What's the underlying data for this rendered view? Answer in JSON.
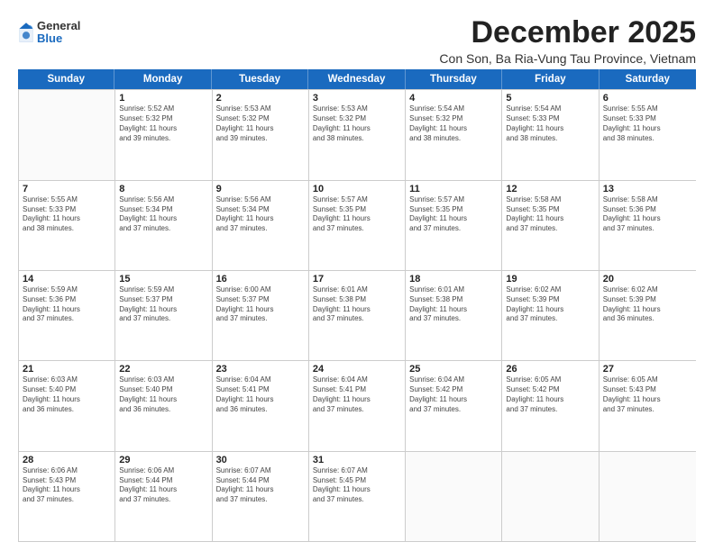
{
  "logo": {
    "general": "General",
    "blue": "Blue"
  },
  "title": "December 2025",
  "location": "Con Son, Ba Ria-Vung Tau Province, Vietnam",
  "days": [
    "Sunday",
    "Monday",
    "Tuesday",
    "Wednesday",
    "Thursday",
    "Friday",
    "Saturday"
  ],
  "weeks": [
    [
      {
        "day": "",
        "info": ""
      },
      {
        "day": "1",
        "info": "Sunrise: 5:52 AM\nSunset: 5:32 PM\nDaylight: 11 hours\nand 39 minutes."
      },
      {
        "day": "2",
        "info": "Sunrise: 5:53 AM\nSunset: 5:32 PM\nDaylight: 11 hours\nand 39 minutes."
      },
      {
        "day": "3",
        "info": "Sunrise: 5:53 AM\nSunset: 5:32 PM\nDaylight: 11 hours\nand 38 minutes."
      },
      {
        "day": "4",
        "info": "Sunrise: 5:54 AM\nSunset: 5:32 PM\nDaylight: 11 hours\nand 38 minutes."
      },
      {
        "day": "5",
        "info": "Sunrise: 5:54 AM\nSunset: 5:33 PM\nDaylight: 11 hours\nand 38 minutes."
      },
      {
        "day": "6",
        "info": "Sunrise: 5:55 AM\nSunset: 5:33 PM\nDaylight: 11 hours\nand 38 minutes."
      }
    ],
    [
      {
        "day": "7",
        "info": "Sunrise: 5:55 AM\nSunset: 5:33 PM\nDaylight: 11 hours\nand 38 minutes."
      },
      {
        "day": "8",
        "info": "Sunrise: 5:56 AM\nSunset: 5:34 PM\nDaylight: 11 hours\nand 37 minutes."
      },
      {
        "day": "9",
        "info": "Sunrise: 5:56 AM\nSunset: 5:34 PM\nDaylight: 11 hours\nand 37 minutes."
      },
      {
        "day": "10",
        "info": "Sunrise: 5:57 AM\nSunset: 5:35 PM\nDaylight: 11 hours\nand 37 minutes."
      },
      {
        "day": "11",
        "info": "Sunrise: 5:57 AM\nSunset: 5:35 PM\nDaylight: 11 hours\nand 37 minutes."
      },
      {
        "day": "12",
        "info": "Sunrise: 5:58 AM\nSunset: 5:35 PM\nDaylight: 11 hours\nand 37 minutes."
      },
      {
        "day": "13",
        "info": "Sunrise: 5:58 AM\nSunset: 5:36 PM\nDaylight: 11 hours\nand 37 minutes."
      }
    ],
    [
      {
        "day": "14",
        "info": "Sunrise: 5:59 AM\nSunset: 5:36 PM\nDaylight: 11 hours\nand 37 minutes."
      },
      {
        "day": "15",
        "info": "Sunrise: 5:59 AM\nSunset: 5:37 PM\nDaylight: 11 hours\nand 37 minutes."
      },
      {
        "day": "16",
        "info": "Sunrise: 6:00 AM\nSunset: 5:37 PM\nDaylight: 11 hours\nand 37 minutes."
      },
      {
        "day": "17",
        "info": "Sunrise: 6:01 AM\nSunset: 5:38 PM\nDaylight: 11 hours\nand 37 minutes."
      },
      {
        "day": "18",
        "info": "Sunrise: 6:01 AM\nSunset: 5:38 PM\nDaylight: 11 hours\nand 37 minutes."
      },
      {
        "day": "19",
        "info": "Sunrise: 6:02 AM\nSunset: 5:39 PM\nDaylight: 11 hours\nand 37 minutes."
      },
      {
        "day": "20",
        "info": "Sunrise: 6:02 AM\nSunset: 5:39 PM\nDaylight: 11 hours\nand 36 minutes."
      }
    ],
    [
      {
        "day": "21",
        "info": "Sunrise: 6:03 AM\nSunset: 5:40 PM\nDaylight: 11 hours\nand 36 minutes."
      },
      {
        "day": "22",
        "info": "Sunrise: 6:03 AM\nSunset: 5:40 PM\nDaylight: 11 hours\nand 36 minutes."
      },
      {
        "day": "23",
        "info": "Sunrise: 6:04 AM\nSunset: 5:41 PM\nDaylight: 11 hours\nand 36 minutes."
      },
      {
        "day": "24",
        "info": "Sunrise: 6:04 AM\nSunset: 5:41 PM\nDaylight: 11 hours\nand 37 minutes."
      },
      {
        "day": "25",
        "info": "Sunrise: 6:04 AM\nSunset: 5:42 PM\nDaylight: 11 hours\nand 37 minutes."
      },
      {
        "day": "26",
        "info": "Sunrise: 6:05 AM\nSunset: 5:42 PM\nDaylight: 11 hours\nand 37 minutes."
      },
      {
        "day": "27",
        "info": "Sunrise: 6:05 AM\nSunset: 5:43 PM\nDaylight: 11 hours\nand 37 minutes."
      }
    ],
    [
      {
        "day": "28",
        "info": "Sunrise: 6:06 AM\nSunset: 5:43 PM\nDaylight: 11 hours\nand 37 minutes."
      },
      {
        "day": "29",
        "info": "Sunrise: 6:06 AM\nSunset: 5:44 PM\nDaylight: 11 hours\nand 37 minutes."
      },
      {
        "day": "30",
        "info": "Sunrise: 6:07 AM\nSunset: 5:44 PM\nDaylight: 11 hours\nand 37 minutes."
      },
      {
        "day": "31",
        "info": "Sunrise: 6:07 AM\nSunset: 5:45 PM\nDaylight: 11 hours\nand 37 minutes."
      },
      {
        "day": "",
        "info": ""
      },
      {
        "day": "",
        "info": ""
      },
      {
        "day": "",
        "info": ""
      }
    ]
  ]
}
